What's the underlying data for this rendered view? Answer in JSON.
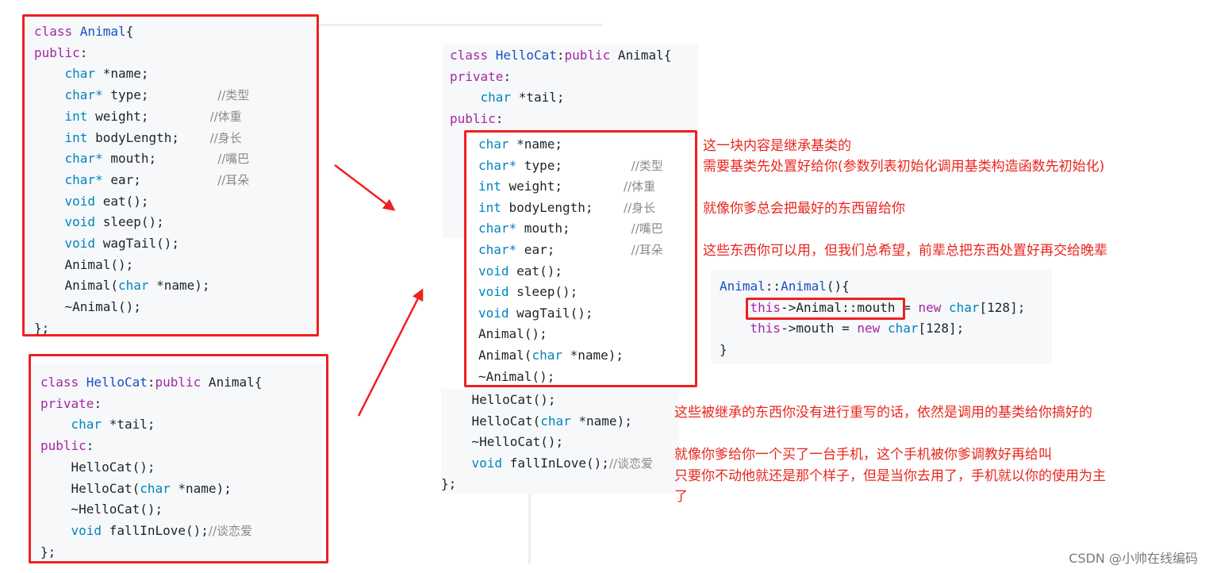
{
  "panel1": {
    "lines": [
      [
        {
          "t": "class ",
          "c": "kw"
        },
        {
          "t": "Animal",
          "c": "cls"
        },
        {
          "t": "{"
        }
      ],
      [
        {
          "t": "public",
          "c": "kw"
        },
        {
          "t": ":"
        }
      ],
      [
        {
          "t": "    "
        },
        {
          "t": "char",
          "c": "ty"
        },
        {
          "t": " *name;"
        }
      ],
      [
        {
          "t": "    "
        },
        {
          "t": "char*",
          "c": "ty"
        },
        {
          "t": " type;         "
        },
        {
          "t": "//类型",
          "c": "cm"
        }
      ],
      [
        {
          "t": "    "
        },
        {
          "t": "int",
          "c": "ty"
        },
        {
          "t": " weight;        "
        },
        {
          "t": "//体重",
          "c": "cm"
        }
      ],
      [
        {
          "t": "    "
        },
        {
          "t": "int",
          "c": "ty"
        },
        {
          "t": " bodyLength;    "
        },
        {
          "t": "//身长",
          "c": "cm"
        }
      ],
      [
        {
          "t": "    "
        },
        {
          "t": "char*",
          "c": "ty"
        },
        {
          "t": " mouth;        "
        },
        {
          "t": "//嘴巴",
          "c": "cm"
        }
      ],
      [
        {
          "t": "    "
        },
        {
          "t": "char*",
          "c": "ty"
        },
        {
          "t": " ear;          "
        },
        {
          "t": "//耳朵",
          "c": "cm"
        }
      ],
      [
        {
          "t": "    "
        },
        {
          "t": "void",
          "c": "ty"
        },
        {
          "t": " eat();"
        }
      ],
      [
        {
          "t": "    "
        },
        {
          "t": "void",
          "c": "ty"
        },
        {
          "t": " sleep();"
        }
      ],
      [
        {
          "t": "    "
        },
        {
          "t": "void",
          "c": "ty"
        },
        {
          "t": " wagTail();"
        }
      ],
      [
        {
          "t": "    Animal();"
        }
      ],
      [
        {
          "t": "    Animal("
        },
        {
          "t": "char",
          "c": "ty"
        },
        {
          "t": " *name);"
        }
      ],
      [
        {
          "t": "    ~Animal();"
        }
      ],
      [
        {
          "t": "};"
        }
      ]
    ]
  },
  "panel2": {
    "lines": [
      [
        {
          "t": "class ",
          "c": "kw"
        },
        {
          "t": "HelloCat",
          "c": "cls"
        },
        {
          "t": ":"
        },
        {
          "t": "public",
          "c": "kw"
        },
        {
          "t": " Animal{"
        }
      ],
      [
        {
          "t": "private",
          "c": "kw"
        },
        {
          "t": ":"
        }
      ],
      [
        {
          "t": "    "
        },
        {
          "t": "char",
          "c": "ty"
        },
        {
          "t": " *tail;"
        }
      ],
      [
        {
          "t": "public",
          "c": "kw"
        },
        {
          "t": ":"
        }
      ],
      [
        {
          "t": "    HelloCat();"
        }
      ],
      [
        {
          "t": "    HelloCat("
        },
        {
          "t": "char",
          "c": "ty"
        },
        {
          "t": " *name);"
        }
      ],
      [
        {
          "t": "    ~HelloCat();"
        }
      ],
      [
        {
          "t": "    "
        },
        {
          "t": "void",
          "c": "ty"
        },
        {
          "t": " fallInLove();"
        },
        {
          "t": "//谈恋爱",
          "c": "cm"
        }
      ],
      [
        {
          "t": "};"
        }
      ]
    ]
  },
  "panel3top": {
    "lines": [
      [
        {
          "t": "class ",
          "c": "kw"
        },
        {
          "t": "HelloCat",
          "c": "cls"
        },
        {
          "t": ":"
        },
        {
          "t": "public",
          "c": "kw"
        },
        {
          "t": " Animal{"
        }
      ],
      [
        {
          "t": "private",
          "c": "kw"
        },
        {
          "t": ":"
        }
      ],
      [
        {
          "t": "    "
        },
        {
          "t": "char",
          "c": "ty"
        },
        {
          "t": " *tail;"
        }
      ],
      [
        {
          "t": "public",
          "c": "kw"
        },
        {
          "t": ":"
        }
      ]
    ]
  },
  "panel3inherited": {
    "lines": [
      [
        {
          "t": "char",
          "c": "ty"
        },
        {
          "t": " *name;"
        }
      ],
      [
        {
          "t": "char*",
          "c": "ty"
        },
        {
          "t": " type;         "
        },
        {
          "t": "//类型",
          "c": "cm"
        }
      ],
      [
        {
          "t": "int",
          "c": "ty"
        },
        {
          "t": " weight;        "
        },
        {
          "t": "//体重",
          "c": "cm"
        }
      ],
      [
        {
          "t": "int",
          "c": "ty"
        },
        {
          "t": " bodyLength;    "
        },
        {
          "t": "//身长",
          "c": "cm"
        }
      ],
      [
        {
          "t": "char*",
          "c": "ty"
        },
        {
          "t": " mouth;        "
        },
        {
          "t": "//嘴巴",
          "c": "cm"
        }
      ],
      [
        {
          "t": "char*",
          "c": "ty"
        },
        {
          "t": " ear;          "
        },
        {
          "t": "//耳朵",
          "c": "cm"
        }
      ],
      [
        {
          "t": "void",
          "c": "ty"
        },
        {
          "t": " eat();"
        }
      ],
      [
        {
          "t": "void",
          "c": "ty"
        },
        {
          "t": " sleep();"
        }
      ],
      [
        {
          "t": "void",
          "c": "ty"
        },
        {
          "t": " wagTail();"
        }
      ],
      [
        {
          "t": "Animal();"
        }
      ],
      [
        {
          "t": "Animal("
        },
        {
          "t": "char",
          "c": "ty"
        },
        {
          "t": " *name);"
        }
      ],
      [
        {
          "t": "~Animal();"
        }
      ]
    ]
  },
  "panel3bottom": {
    "lines": [
      [
        {
          "t": "    HelloCat();"
        }
      ],
      [
        {
          "t": "    HelloCat("
        },
        {
          "t": "char",
          "c": "ty"
        },
        {
          "t": " *name);"
        }
      ],
      [
        {
          "t": "    ~HelloCat();"
        }
      ],
      [
        {
          "t": "    "
        },
        {
          "t": "void",
          "c": "ty"
        },
        {
          "t": " fallInLove();"
        },
        {
          "t": "//谈恋爱",
          "c": "cm"
        }
      ],
      [
        {
          "t": "};"
        }
      ]
    ]
  },
  "ctor": {
    "lines": [
      [
        {
          "t": "Animal",
          "c": "cls"
        },
        {
          "t": "::"
        },
        {
          "t": "Animal",
          "c": "cls"
        },
        {
          "t": "(){"
        }
      ],
      [
        {
          "t": "    "
        },
        {
          "t": "this",
          "c": "kw"
        },
        {
          "t": "->Animal::mouth = "
        },
        {
          "t": "new",
          "c": "kw"
        },
        {
          "t": " "
        },
        {
          "t": "char",
          "c": "ty"
        },
        {
          "t": "[128];"
        }
      ],
      [
        {
          "t": "    "
        },
        {
          "t": "this",
          "c": "kw"
        },
        {
          "t": "->mouth = "
        },
        {
          "t": "new",
          "c": "kw"
        },
        {
          "t": " "
        },
        {
          "t": "char",
          "c": "ty"
        },
        {
          "t": "[128];"
        }
      ],
      [
        {
          "t": "}"
        }
      ]
    ]
  },
  "notes": {
    "note1": "这一块内容是继承基类的",
    "note2": "需要基类先处置好给你(参数列表初始化调用基类构造函数先初始化)",
    "note3": "就像你爹总会把最好的东西留给你",
    "note4": "这些东西你可以用，但我们总希望，前辈总把东西处置好再交给晚辈",
    "note5": "这些被继承的东西你没有进行重写的话，依然是调用的基类给你搞好的",
    "note6": "就像你爹给你一个买了一台手机，这个手机被你爹调教好再给叫",
    "note7": "只要你不动他就还是那个样子，但是当你去用了，手机就以你的使用为主",
    "note8": "了"
  },
  "watermark": "CSDN @小帅在线编码",
  "colors": {
    "annotation": "#e8261e",
    "keyword": "#a626a4",
    "type": "#0184bc",
    "class": "#1a4fc4",
    "comment": "#8a8a8a"
  }
}
